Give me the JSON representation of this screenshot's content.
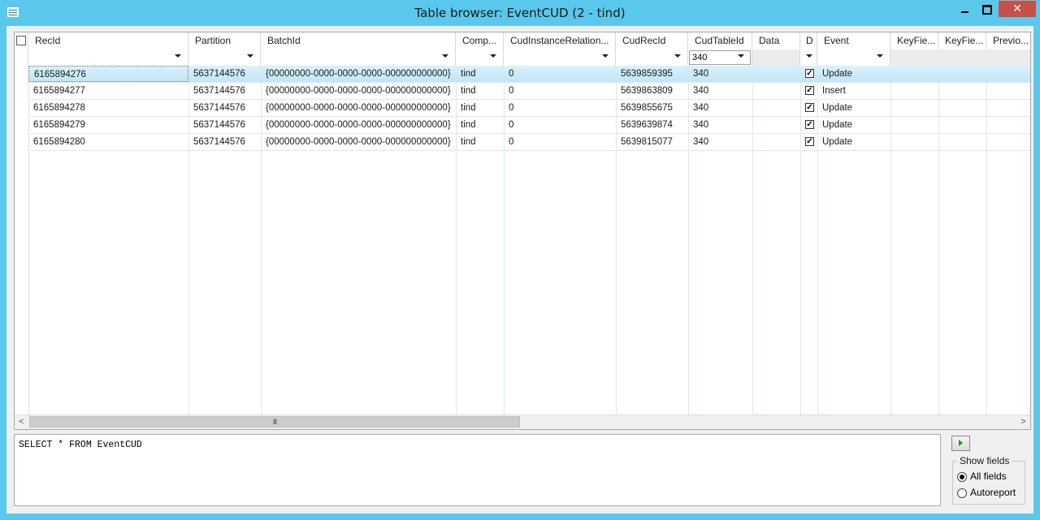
{
  "window": {
    "title": "Table browser: EventCUD (2 - tind)",
    "close_glyph": "✕"
  },
  "grid": {
    "columns": [
      "RecId",
      "Partition",
      "BatchId",
      "Comp...",
      "CudInstanceRelation...",
      "CudRecId",
      "CudTableId",
      "Data",
      "D",
      "Event",
      "KeyFie...",
      "KeyFie...",
      "Previo..."
    ],
    "filters": {
      "cud_table_id": "340"
    },
    "rows": [
      {
        "recid": "6165894276",
        "partition": "5637144576",
        "batchid": "{00000000-0000-0000-0000-000000000000}",
        "company": "tind",
        "cud_instance": "0",
        "cud_recid": "5639859395",
        "cud_tableid": "340",
        "d_checked": true,
        "event": "Update"
      },
      {
        "recid": "6165894277",
        "partition": "5637144576",
        "batchid": "{00000000-0000-0000-0000-000000000000}",
        "company": "tind",
        "cud_instance": "0",
        "cud_recid": "5639863809",
        "cud_tableid": "340",
        "d_checked": true,
        "event": "Insert"
      },
      {
        "recid": "6165894278",
        "partition": "5637144576",
        "batchid": "{00000000-0000-0000-0000-000000000000}",
        "company": "tind",
        "cud_instance": "0",
        "cud_recid": "5639855675",
        "cud_tableid": "340",
        "d_checked": true,
        "event": "Update"
      },
      {
        "recid": "6165894279",
        "partition": "5637144576",
        "batchid": "{00000000-0000-0000-0000-000000000000}",
        "company": "tind",
        "cud_instance": "0",
        "cud_recid": "5639639874",
        "cud_tableid": "340",
        "d_checked": true,
        "event": "Update"
      },
      {
        "recid": "6165894280",
        "partition": "5637144576",
        "batchid": "{00000000-0000-0000-0000-000000000000}",
        "company": "tind",
        "cud_instance": "0",
        "cud_recid": "5639815077",
        "cud_tableid": "340",
        "d_checked": true,
        "event": "Update"
      }
    ],
    "scroll": {
      "left_arrow": "<",
      "right_arrow": ">",
      "thumb_grip": "III"
    }
  },
  "query": {
    "text": "SELECT * FROM EventCUD"
  },
  "show_fields": {
    "legend": "Show fields",
    "options": [
      {
        "label": "All fields",
        "selected": true
      },
      {
        "label": "Autoreport",
        "selected": false
      }
    ]
  },
  "colors": {
    "title_bar": "#5ac8ec",
    "selected_row": "#c7e8f9",
    "close_button": "#c7504a"
  }
}
